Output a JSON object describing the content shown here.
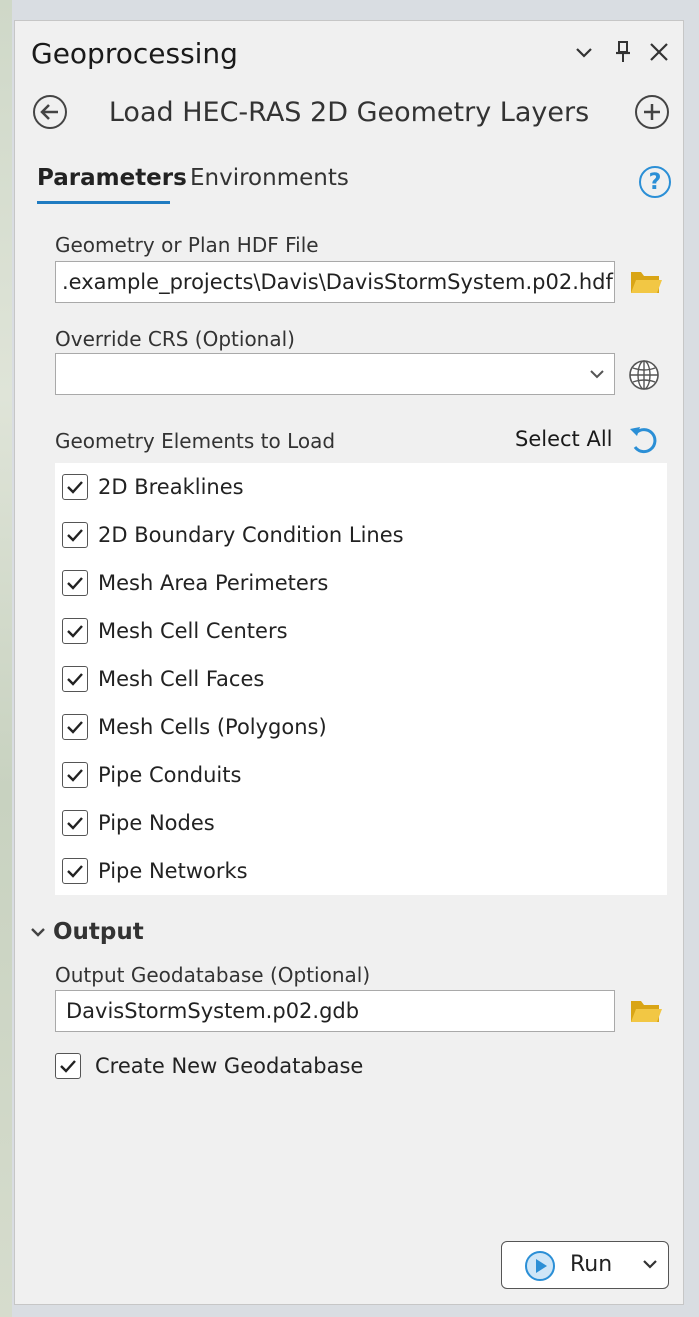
{
  "pane": {
    "title": "Geoprocessing",
    "controls": [
      "chevron-down-icon",
      "pin-icon",
      "close-icon"
    ]
  },
  "tool": {
    "title": "Load HEC-RAS 2D Geometry Layers",
    "back_icon": "back-arrow-icon",
    "add_icon": "add-icon"
  },
  "tabs": [
    {
      "label": "Parameters",
      "active": true
    },
    {
      "label": "Environments",
      "active": false
    }
  ],
  "help": {
    "label": "?"
  },
  "params": {
    "hdf_file": {
      "label": "Geometry or Plan HDF File",
      "value": ".example_projects\\Davis\\DavisStormSystem.p02.hdf",
      "icon": "folder-icon"
    },
    "crs": {
      "label": "Override CRS (Optional)",
      "value": "",
      "icon": "globe-icon"
    },
    "elements": {
      "label": "Geometry Elements to Load",
      "select_all": "Select All",
      "reset_icon": "reset-icon",
      "items": [
        {
          "label": "2D Breaklines",
          "checked": true
        },
        {
          "label": "2D Boundary Condition Lines",
          "checked": true
        },
        {
          "label": "Mesh Area Perimeters",
          "checked": true
        },
        {
          "label": "Mesh Cell Centers",
          "checked": true
        },
        {
          "label": "Mesh Cell Faces",
          "checked": true
        },
        {
          "label": "Mesh Cells (Polygons)",
          "checked": true
        },
        {
          "label": "Pipe Conduits",
          "checked": true
        },
        {
          "label": "Pipe Nodes",
          "checked": true
        },
        {
          "label": "Pipe Networks",
          "checked": true
        }
      ]
    }
  },
  "output": {
    "section_label": "Output",
    "gdb": {
      "label": "Output Geodatabase (Optional)",
      "value": "DavisStormSystem.p02.gdb",
      "icon": "folder-icon"
    },
    "create_new": {
      "label": "Create New Geodatabase",
      "checked": true
    }
  },
  "run": {
    "label": "Run"
  },
  "colors": {
    "accent": "#1f7bc1",
    "folder": "#e6b727",
    "help": "#2b8fd6",
    "panel_bg": "#f0f0f0"
  }
}
